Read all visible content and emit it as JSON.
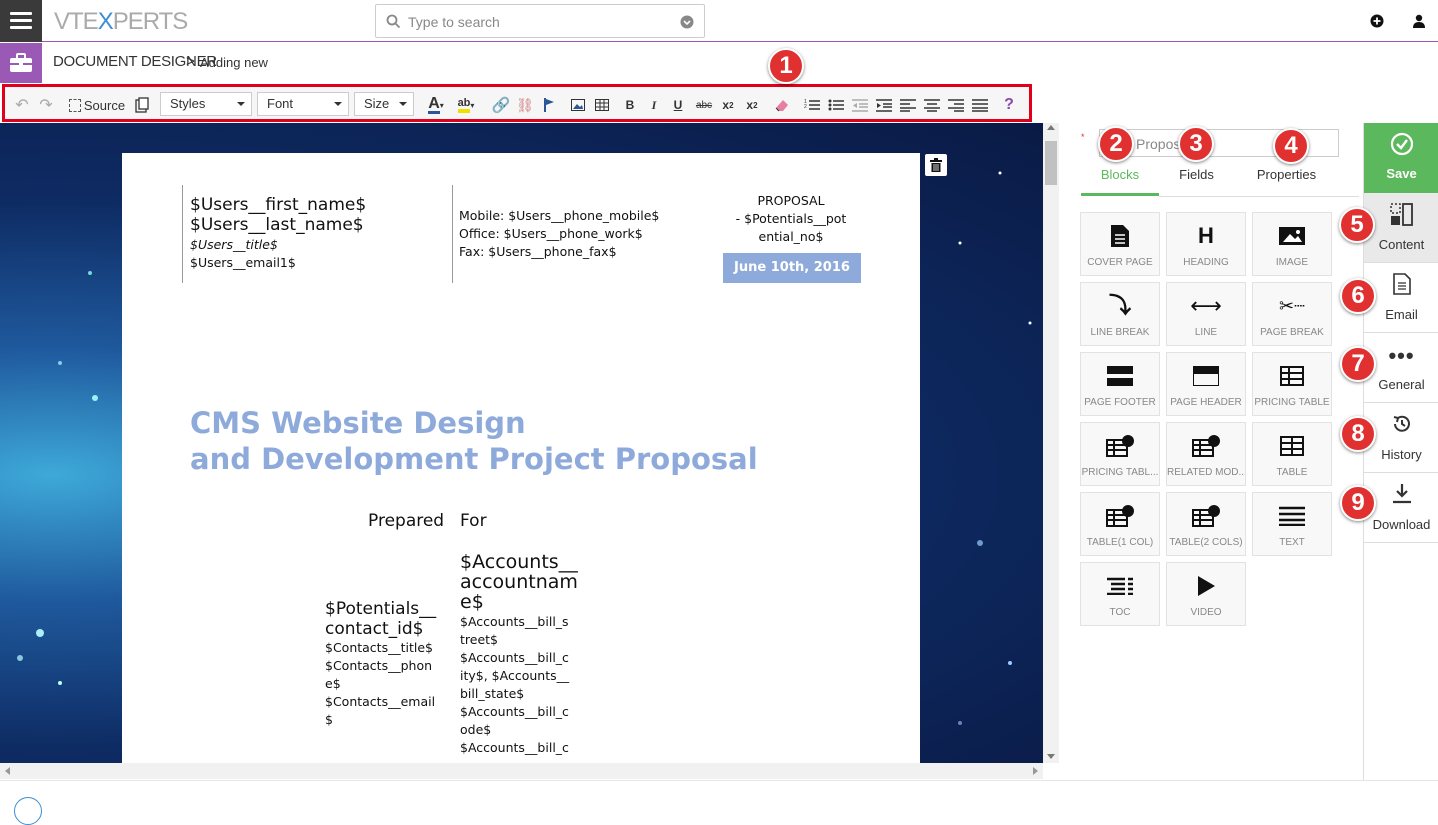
{
  "app": {
    "logo_pre": "VTE",
    "logo_x": "X",
    "logo_post": "PERTS"
  },
  "search": {
    "placeholder": "Type to search"
  },
  "breadcrumb": {
    "module": "DOCUMENT DESIGNER",
    "sep": ">",
    "page": "Adding new"
  },
  "toolbar": {
    "source_label": "Source",
    "styles_label": "Styles",
    "font_label": "Font",
    "size_label": "Size",
    "help": "?"
  },
  "document": {
    "user_first": "$Users__first_name$",
    "user_last": "$Users__last_name$",
    "user_title": "$Users__title$",
    "user_email": "$Users__email1$",
    "mobile": "Mobile: $Users__phone_mobile$",
    "office": "Office: $Users__phone_work$",
    "fax": "Fax: $Users__phone_fax$",
    "proposal_l1": "PROPOSAL",
    "proposal_l2": "- $Potentials__pot",
    "proposal_l3": "ential_no$",
    "date": "June 10th, 2016",
    "title_l1": "CMS Website Design",
    "title_l2": "and Development Project Proposal",
    "prepared": "Prepared",
    "for": "For",
    "contact_l1": "$Potentials__",
    "contact_l2": "contact_id$",
    "contact_title": "$Contacts__title$",
    "contact_phone_l1": "$Contacts__phon",
    "contact_phone_l2": "e$",
    "contact_email_l1": "$Contacts__email",
    "contact_email_l2": "$",
    "acc_l1": "$Accounts__",
    "acc_l2": "accountnam",
    "acc_l3": "e$",
    "acc_street_l1": "$Accounts__bill_s",
    "acc_street_l2": "treet$",
    "acc_city_l1": "$Accounts__bill_c",
    "acc_city_l2": "ity$, $Accounts__",
    "acc_city_l3": "bill_state$",
    "acc_code_l1": "$Accounts__bill_c",
    "acc_code_l2": "ode$",
    "acc_country_l1": "$Accounts__bill_c"
  },
  "right_panel": {
    "name_value": "Propos",
    "tabs": [
      "Blocks",
      "Fields",
      "Properties"
    ],
    "active_tab": "Blocks",
    "blocks": [
      "COVER PAGE",
      "HEADING",
      "IMAGE",
      "LINE BREAK",
      "LINE",
      "PAGE BREAK",
      "PAGE FOOTER",
      "PAGE HEADER",
      "PRICING TABLE",
      "PRICING TABL...",
      "RELATED MOD...",
      "TABLE",
      "TABLE(1 COL)",
      "TABLE(2 COLS)",
      "TEXT",
      "TOC",
      "VIDEO"
    ]
  },
  "side_nav": {
    "save": "Save",
    "items": [
      "Content",
      "Email",
      "General",
      "History",
      "Download"
    ]
  },
  "badges": [
    "1",
    "2",
    "3",
    "4",
    "5",
    "6",
    "7",
    "8",
    "9"
  ],
  "colors": {
    "accent": "#9b59b6",
    "save": "#5cb85c",
    "tab_active": "#5cb85c",
    "highlight": "#e0001b",
    "title": "#8eaadb"
  }
}
